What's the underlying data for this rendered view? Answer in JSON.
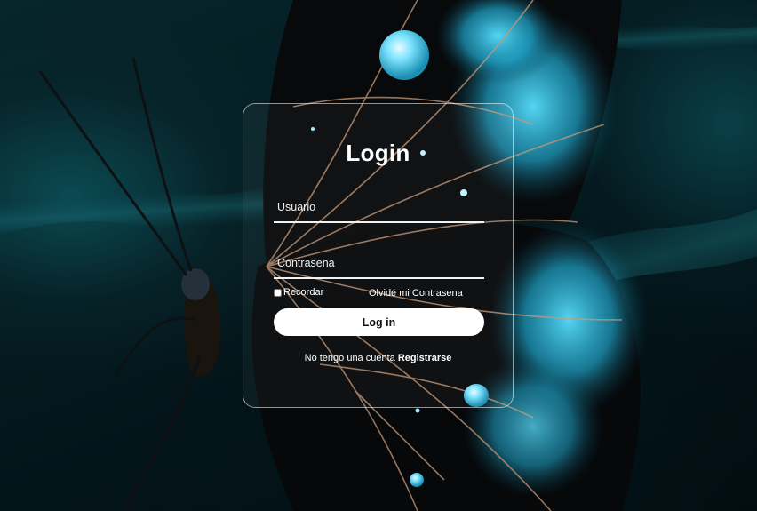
{
  "login": {
    "title": "Login",
    "username_placeholder": "Usuario",
    "password_placeholder": "Contrasena",
    "remember_label": "Recordar",
    "forgot_label": "Olvidé mi Contrasena",
    "submit_label": "Log in",
    "no_account_text": "No tengo una cuenta",
    "register_label": "Registrarse"
  },
  "colors": {
    "background_dark": "#041a1f",
    "accent_cyan": "#2fc4e6",
    "text": "#ffffff",
    "button_bg": "#ffffff"
  }
}
